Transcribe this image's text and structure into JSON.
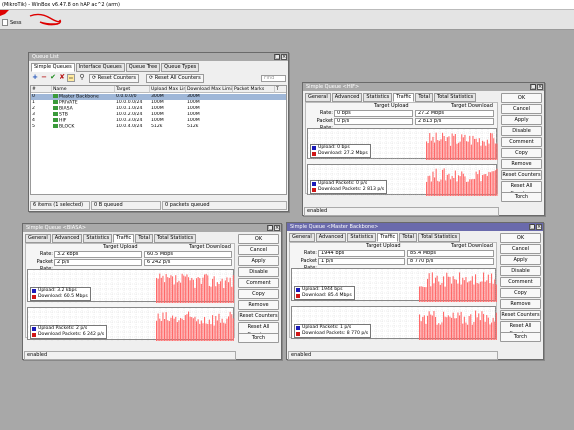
{
  "app": {
    "title": "(MikroTik) - WinBox v6.47.8 on hAP ac^2 (arm)",
    "menu_label": "Sess"
  },
  "colors": {
    "upload": "#1a1ab8",
    "download": "#d01616",
    "graph_bar": "#ff6a6a"
  },
  "queue_list": {
    "title": "Queue List",
    "tabs": [
      "Simple Queues",
      "Interface Queues",
      "Queue Tree",
      "Queue Types"
    ],
    "toolbar": {
      "reset_counters": "Reset Counters",
      "reset_all_counters": "Reset All Counters",
      "find_placeholder": "Find"
    },
    "columns": [
      "#",
      "Name",
      "Target",
      "Upload Max Limit",
      "Download Max Limit",
      "Packet Marks",
      "T"
    ],
    "rows": [
      {
        "num": "0",
        "name": "Master Backbone",
        "target": "0.0.0.0/0",
        "up": "300M",
        "down": "300M",
        "selected": true
      },
      {
        "num": "1",
        "name": "PRIVATE",
        "target": "10.0.0.0/24",
        "up": "100M",
        "down": "100M"
      },
      {
        "num": "2",
        "name": "BIASA",
        "target": "10.0.1.0/24",
        "up": "100M",
        "down": "100M"
      },
      {
        "num": "3",
        "name": "STB",
        "target": "10.0.2.0/24",
        "up": "100M",
        "down": "100M"
      },
      {
        "num": "4",
        "name": "HIF",
        "target": "10.0.3.0/24",
        "up": "100M",
        "down": "100M"
      },
      {
        "num": "5",
        "name": "BLOCK",
        "target": "10.0.4.0/24",
        "up": "512k",
        "down": "512k"
      }
    ],
    "status": {
      "items": "6 items (1 selected)",
      "queued": "0 B queued",
      "packets": "0 packets queued"
    }
  },
  "buttons": {
    "ok": "OK",
    "cancel": "Cancel",
    "apply": "Apply",
    "disable": "Disable",
    "comment": "Comment",
    "copy": "Copy",
    "remove": "Remove",
    "reset_counters": "Reset Counters",
    "reset_all_counters": "Reset All Counters",
    "torch": "Torch"
  },
  "windows": [
    {
      "id": "hif",
      "title": "Simple Queue <HIF>",
      "tabs": [
        "General",
        "Advanced",
        "Statistics",
        "Traffic",
        "Total",
        "Total Statistics"
      ],
      "selected_tab": "Traffic",
      "target_upload_label": "Target Upload",
      "target_download_label": "Target Download",
      "rate_label": "Rate:",
      "packet_rate_label": "Packet Rate:",
      "rate_up": "0 bps",
      "rate_down": "27.2 Mbps",
      "pkt_up": "0 p/s",
      "pkt_down": "2 813 p/s",
      "legend_upload": "Upload: 0 bps",
      "legend_download": "Download: 27.2 Mbps",
      "legend_upload_pkts": "Upload Packets: 0 p/s",
      "legend_download_pkts": "Download Packets: 2 813 p/s",
      "status": "enabled"
    },
    {
      "id": "biasa",
      "title": "Simple Queue <BIASA>",
      "tabs": [
        "General",
        "Advanced",
        "Statistics",
        "Traffic",
        "Total",
        "Total Statistics"
      ],
      "selected_tab": "Traffic",
      "target_upload_label": "Target Upload",
      "target_download_label": "Target Download",
      "rate_label": "Rate:",
      "packet_rate_label": "Packet Rate:",
      "rate_up": "3.2 kbps",
      "rate_down": "60.5 Mbps",
      "pkt_up": "2 p/s",
      "pkt_down": "6 242 p/s",
      "legend_upload": "Upload: 3.2 kbps",
      "legend_download": "Download: 60.5 Mbps",
      "legend_upload_pkts": "Upload Packets: 2 p/s",
      "legend_download_pkts": "Download Packets: 6 242 p/s",
      "status": "enabled"
    },
    {
      "id": "master",
      "title": "Simple Queue <Master Backbone>",
      "tabs": [
        "General",
        "Advanced",
        "Statistics",
        "Traffic",
        "Total",
        "Total Statistics"
      ],
      "selected_tab": "Traffic",
      "target_upload_label": "Target Upload",
      "target_download_label": "Target Download",
      "rate_label": "Rate:",
      "packet_rate_label": "Packet Rate:",
      "rate_up": "1944 bps",
      "rate_down": "85.4 Mbps",
      "pkt_up": "1 p/s",
      "pkt_down": "8 770 p/s",
      "legend_upload": "Upload: 1944 bps",
      "legend_download": "Download: 85.4 Mbps",
      "legend_upload_pkts": "Upload Packets: 1 p/s",
      "legend_download_pkts": "Download Packets: 8 770 p/s",
      "status": "enabled"
    }
  ]
}
